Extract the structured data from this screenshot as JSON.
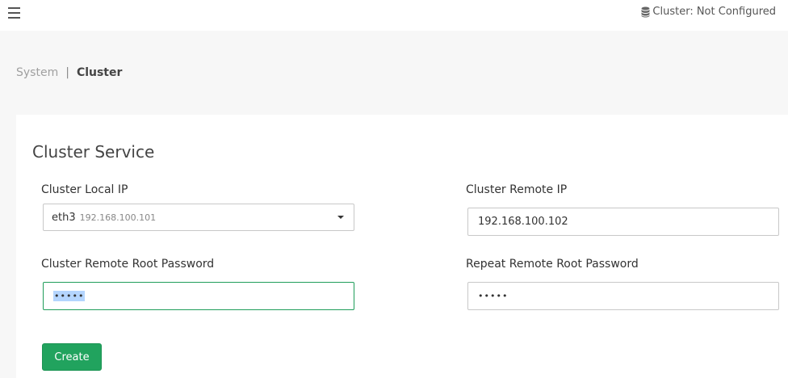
{
  "topbar": {
    "menu_icon": "hamburger-menu-icon",
    "cluster_icon": "database-icon",
    "cluster_status": "Cluster: Not Configured"
  },
  "breadcrumb": {
    "parent": "System",
    "separator": "|",
    "current": "Cluster"
  },
  "panel": {
    "title": "Cluster Service",
    "local_ip": {
      "label": "Cluster Local IP",
      "selected_interface": "eth3",
      "selected_ip": "192.168.100.101"
    },
    "remote_ip": {
      "label": "Cluster Remote IP",
      "value": "192.168.100.102"
    },
    "remote_password": {
      "label": "Cluster Remote Root Password",
      "value": "•••••"
    },
    "repeat_password": {
      "label": "Repeat Remote Root Password",
      "value": "•••••"
    },
    "create_label": "Create"
  },
  "colors": {
    "accent": "#21a35e",
    "focus_border": "#1f9d5a",
    "selection": "#b4d5fe"
  }
}
